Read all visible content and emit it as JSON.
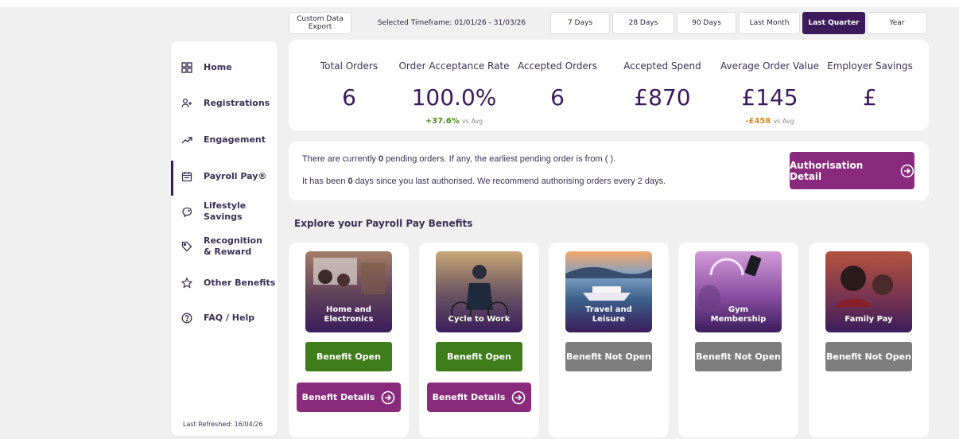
{
  "filters": {
    "export_label": "Custom Data Export",
    "timeframe_label": "Selected Timeframe: 01/01/26 - 31/03/26",
    "options": [
      "7 Days",
      "28 Days",
      "90 Days",
      "Last Month",
      "Last Quarter",
      "Year"
    ],
    "active": "Last Quarter"
  },
  "sidebar": {
    "items": [
      {
        "label": "Home",
        "icon": "grid-icon"
      },
      {
        "label": "Registrations",
        "icon": "users-icon"
      },
      {
        "label": "Engagement",
        "icon": "trend-icon"
      },
      {
        "label": "Payroll Pay®",
        "icon": "calendar-icon",
        "active": true
      },
      {
        "label": "Lifestyle Savings",
        "icon": "piggy-bank-icon"
      },
      {
        "label_line1": "Recognition",
        "label_line2": "& Reward",
        "icon": "tag-icon"
      },
      {
        "label": "Other Benefits",
        "icon": "star-icon"
      },
      {
        "label": "FAQ / Help",
        "icon": "help-icon"
      }
    ],
    "last_refreshed": "Last Refreshed: 16/04/26"
  },
  "stats": {
    "total_orders": {
      "label": "Total Orders",
      "value": "6"
    },
    "acceptance_rate": {
      "label": "Order Acceptance Rate",
      "value": "100.0%",
      "delta": "+37.6%",
      "vs": "vs Avg"
    },
    "accepted_orders": {
      "label": "Accepted Orders",
      "value": "6"
    },
    "accepted_spend": {
      "label": "Accepted Spend",
      "value": "£870"
    },
    "average_order": {
      "label": "Average Order Value",
      "value": "£145",
      "delta": "-£458",
      "vs": "vs Avg"
    },
    "employer_savings": {
      "label": "Employer Savings",
      "value": "£"
    }
  },
  "pending": {
    "line1_prefix": "There are currently ",
    "line1_count": "0",
    "line1_suffix": " pending orders. If any, the earliest pending order is from ( ).",
    "line2_prefix": "It has been ",
    "line2_count": "0",
    "line2_suffix": " days since you last authorised. We recommend authorising orders every 2 days.",
    "button_label": "Authorisation Detail"
  },
  "section_title": "Explore your Payroll Pay Benefits",
  "benefits": [
    {
      "title": "Home and Electronics",
      "status": "Benefit Open",
      "details": "Benefit Details"
    },
    {
      "title": "Cycle to Work",
      "status": "Benefit Open",
      "details": "Benefit Details"
    },
    {
      "title": "Travel and Leisure",
      "status": "Benefit Not Open"
    },
    {
      "title": "Gym Membership",
      "status": "Benefit Not Open"
    },
    {
      "title": "Family Pay",
      "status": "Benefit Not Open"
    }
  ],
  "colors": {
    "brand_purple": "#3c1a5b",
    "accent_magenta": "#8a2a7d",
    "open_green": "#3e7d1a",
    "closed_grey": "#7e7e7e",
    "delta_positive": "#4e8a18",
    "delta_negative": "#e08a1e"
  }
}
